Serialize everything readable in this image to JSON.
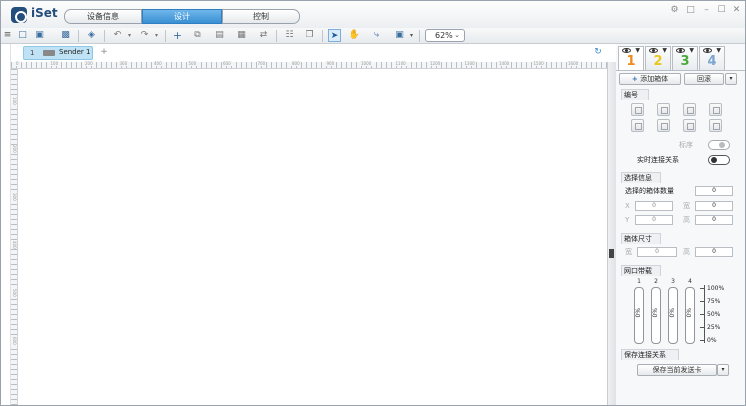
{
  "app": {
    "brand": "iSet"
  },
  "main_tabs": [
    {
      "label": "设备信息"
    },
    {
      "label": "设计"
    },
    {
      "label": "控制"
    }
  ],
  "window_controls": [
    "settings-icon",
    "monitor-icon",
    "minimize-icon",
    "maximize-icon",
    "close-icon"
  ],
  "toolbar": {
    "zoom_value": "62%",
    "icons": [
      "menu-icon",
      "new-file-icon",
      "open-folder-icon",
      "save-icon",
      "screen-icon",
      "undo-icon",
      "redo-icon",
      "add-icon",
      "copy-icon",
      "paste-icon",
      "delete-icon",
      "replace-icon",
      "grid-icon",
      "layer-icon",
      "select-icon",
      "hand-icon",
      "connect-icon",
      "frame-icon"
    ]
  },
  "doc_tabs": [
    {
      "number": "1",
      "label": "Sender 1"
    }
  ],
  "ruler": {
    "h_marks": [
      "0",
      "100",
      "200",
      "300",
      "400",
      "500",
      "600",
      "700",
      "800",
      "900",
      "1000",
      "1100",
      "1200",
      "1300",
      "1400",
      "1500",
      "1600"
    ],
    "v_marks": [
      "100",
      "200",
      "300",
      "400",
      "500",
      "600"
    ]
  },
  "panel": {
    "tabs": [
      {
        "number": "1",
        "color": "#f08a1c"
      },
      {
        "number": "2",
        "color": "#e8c81c"
      },
      {
        "number": "3",
        "color": "#4aa93a"
      },
      {
        "number": "4",
        "color": "#7aa6cf"
      }
    ],
    "add_box_label": "添加箱体",
    "rollback_label": "回滚",
    "numbering_title": "编号",
    "sort_label": "标序",
    "live_connection_label": "实时连接关系",
    "selection_title": "选择信息",
    "selected_count_label": "选择的箱体数量",
    "selected_count_value": "0",
    "x_label": "X",
    "y_label": "Y",
    "width_label": "宽",
    "height_label": "高",
    "x_value": "0",
    "y_value": "0",
    "w_value": "0",
    "h_value": "0",
    "box_size_title": "箱体尺寸",
    "box_w_value": "0",
    "box_h_value": "0",
    "bandwidth_title": "网口带载",
    "bandwidth": [
      {
        "port": "1",
        "value": "0%"
      },
      {
        "port": "2",
        "value": "0%"
      },
      {
        "port": "3",
        "value": "0%"
      },
      {
        "port": "4",
        "value": "0%"
      }
    ],
    "scale_labels": [
      "100%",
      "75%",
      "50%",
      "25%",
      "0%"
    ],
    "save_connection_title": "保存连接关系",
    "save_to_card_label": "保存当前发送卡"
  }
}
